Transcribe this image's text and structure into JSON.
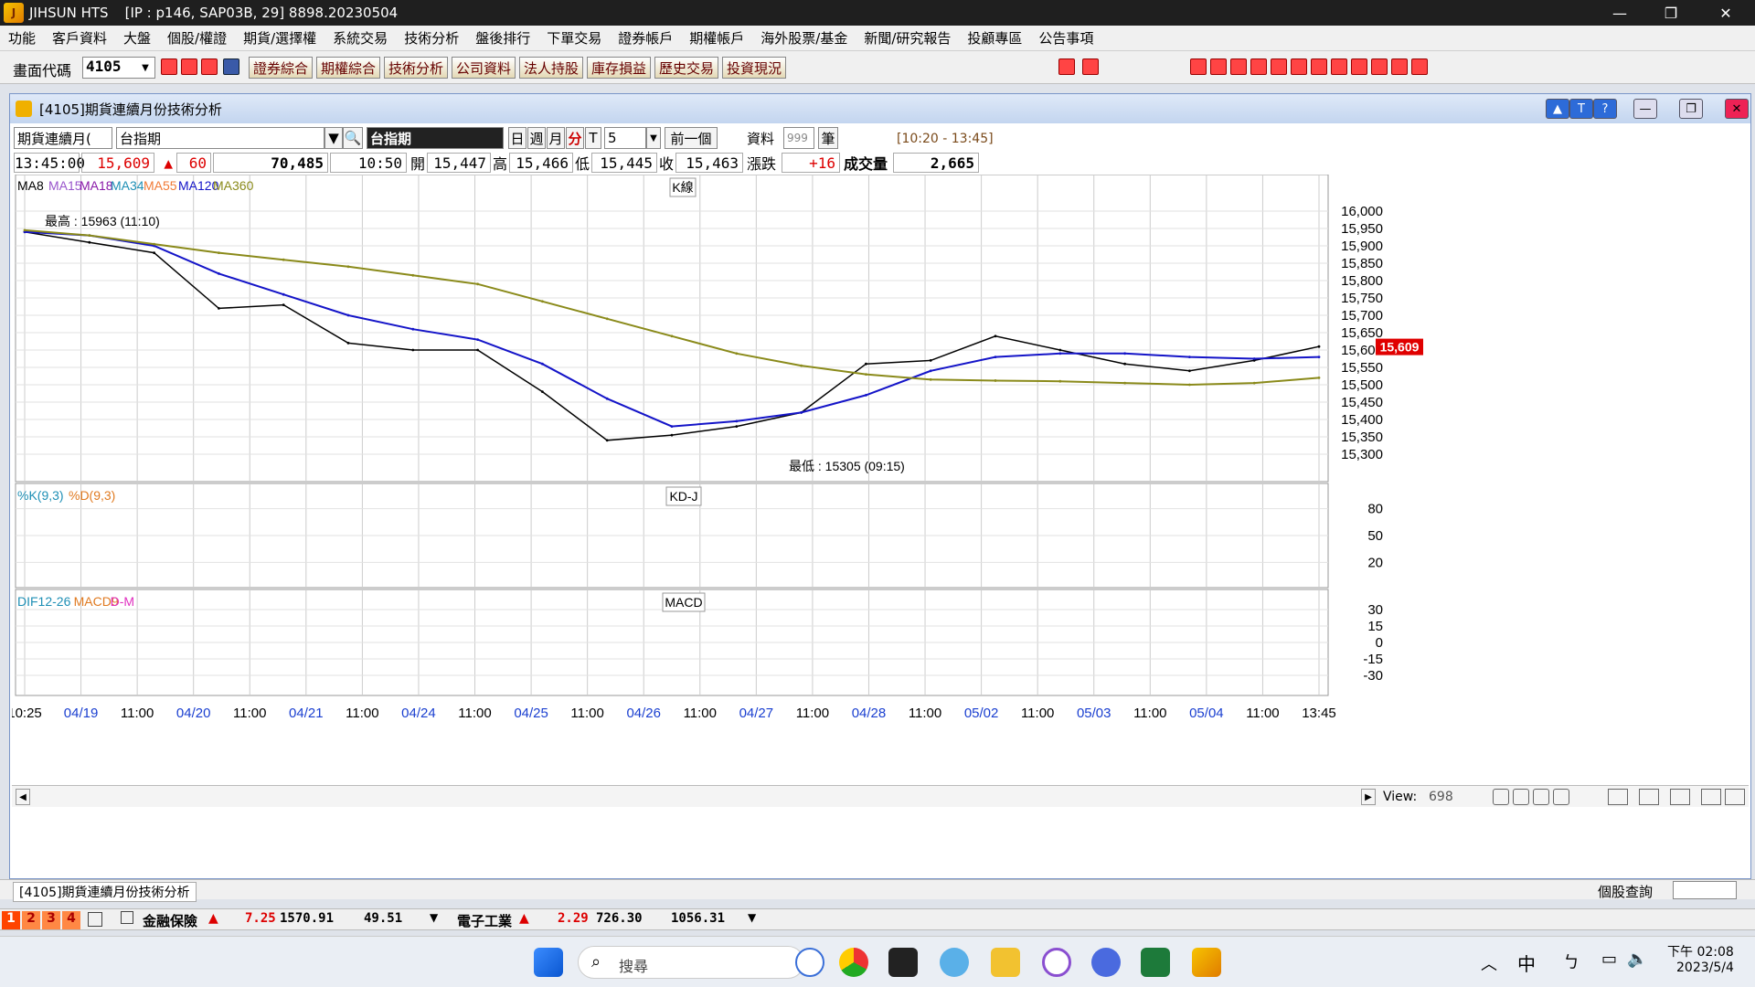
{
  "window": {
    "title": "JIHSUN HTS",
    "info": "[IP : p146, SAP03B, 29] 8898.20230504",
    "min": "—",
    "max": "❐",
    "close": "✕"
  },
  "menu": [
    "功能",
    "客戶資料",
    "大盤",
    "個股/權證",
    "期貨/選擇權",
    "系統交易",
    "技術分析",
    "盤後排行",
    "下單交易",
    "證券帳戶",
    "期權帳戶",
    "海外股票/基金",
    "新聞/研究報告",
    "投顧專區",
    "公告事項"
  ],
  "toolbar": {
    "code_label": "畫面代碼",
    "code_value": "4105",
    "buttons": [
      "證券綜合",
      "期權綜合",
      "技術分析",
      "公司資料",
      "法人持股",
      "庫存損益",
      "歷史交易",
      "投資現況"
    ]
  },
  "chartwin": {
    "title": "[4105]期貨連續月份技術分析",
    "ctrl": {
      "type": "期貨連續月(",
      "symbol": "台指期",
      "name": "台指期",
      "periods": [
        "日",
        "週",
        "月",
        "分",
        "T"
      ],
      "interval": "5",
      "prev": "前一個",
      "data_label": "資料",
      "data_count": "999",
      "unit": "筆",
      "range": "[10:20 - 13:45]"
    },
    "quote": {
      "time": "13:45:00",
      "price": "15,609",
      "change": "60",
      "volume_total": "70,485",
      "qtime": "10:50",
      "open_label": "開",
      "open": "15,447",
      "high_label": "高",
      "high": "15,466",
      "low_label": "低",
      "low": "15,445",
      "close_label": "收",
      "close": "15,463",
      "chg_label": "漲跌",
      "chg": "+16",
      "vol_label": "成交量",
      "vol": "2,665"
    }
  },
  "colors": {
    "ma8": "#000000",
    "ma15": "#9955cc",
    "ma18": "#8a1aa8",
    "ma34": "#1e8fb5",
    "ma55": "#f07a36",
    "ma120": "#1414c8",
    "ma360": "#8a8a1a",
    "k": "#1e8fb5",
    "d": "#e07a20",
    "pos": "#e030c0",
    "neg": "#1e90ff",
    "up": "#e00000"
  },
  "chart_data": {
    "type": "line",
    "panels": [
      {
        "name": "K線",
        "legend": [
          "MA8",
          "MA15",
          "MA18",
          "MA34",
          "MA55",
          "MA120",
          "MA360"
        ],
        "ylim": [
          15300,
          16000
        ],
        "yticks": [
          16000,
          15950,
          15900,
          15850,
          15800,
          15750,
          15700,
          15650,
          15600,
          15550,
          15500,
          15450,
          15400,
          15350,
          15300
        ],
        "last_price": "15,609",
        "annotations": [
          {
            "text": "最高 : 15963 (11:10)"
          },
          {
            "text": "最低 : 15305 (09:15)"
          }
        ],
        "x": [
          0,
          0.05,
          0.1,
          0.15,
          0.2,
          0.25,
          0.3,
          0.35,
          0.4,
          0.45,
          0.5,
          0.55,
          0.6,
          0.65,
          0.7,
          0.75,
          0.8,
          0.85,
          0.9,
          0.95,
          1
        ],
        "series": [
          {
            "name": "MA8",
            "values": [
              15940,
              15910,
              15880,
              15720,
              15730,
              15620,
              15600,
              15600,
              15480,
              15340,
              15355,
              15380,
              15420,
              15560,
              15570,
              15640,
              15600,
              15560,
              15540,
              15570,
              15610
            ]
          },
          {
            "name": "MA120",
            "values": [
              15940,
              15930,
              15900,
              15820,
              15760,
              15700,
              15660,
              15630,
              15560,
              15460,
              15380,
              15395,
              15420,
              15470,
              15540,
              15580,
              15590,
              15590,
              15580,
              15575,
              15580
            ]
          },
          {
            "name": "MA360",
            "values": [
              15945,
              15930,
              15905,
              15880,
              15860,
              15840,
              15815,
              15790,
              15740,
              15690,
              15640,
              15590,
              15555,
              15530,
              15515,
              15512,
              15510,
              15505,
              15500,
              15505,
              15520
            ]
          }
        ]
      },
      {
        "name": "KD-J",
        "legend": [
          "%K(9,3)",
          "%D(9,3)"
        ],
        "ylim": [
          0,
          100
        ],
        "yticks": [
          80,
          50,
          20
        ]
      },
      {
        "name": "MACD",
        "legend": [
          "DIF12-26",
          "MACD9",
          "D-M"
        ],
        "ylim": [
          -40,
          40
        ],
        "yticks": [
          30,
          15,
          0,
          -15,
          -30
        ]
      }
    ],
    "x_labels": [
      "10:25",
      "04/19",
      "11:00",
      "04/20",
      "11:00",
      "04/21",
      "11:00",
      "04/24",
      "11:00",
      "04/25",
      "11:00",
      "04/26",
      "11:00",
      "04/27",
      "11:00",
      "04/28",
      "11:00",
      "05/02",
      "11:00",
      "05/03",
      "11:00",
      "05/04",
      "11:00",
      "13:45"
    ]
  },
  "scroll": {
    "view_label": "View:",
    "view": "698"
  },
  "status": {
    "tab": "[4105]期貨連續月份技術分析",
    "right": "個股查詢"
  },
  "ticker": {
    "groups": [
      "1",
      "2",
      "3",
      "4"
    ],
    "items": [
      {
        "name": "金融保險",
        "chg": "7.25",
        "v1": "1570.91",
        "v2": "49.51"
      },
      {
        "name": "電子工業",
        "chg": "2.29",
        "v1": "726.30",
        "v2": "1056.31"
      }
    ]
  },
  "taskbar": {
    "search": "搜尋",
    "time": "下午 02:08",
    "date": "2023/5/4",
    "ime": "中"
  }
}
